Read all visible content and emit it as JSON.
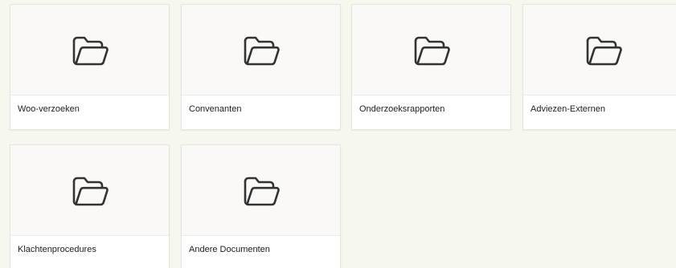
{
  "folders": [
    {
      "label": "Woo-verzoeken",
      "icon": "folder-icon"
    },
    {
      "label": "Convenanten",
      "icon": "folder-icon"
    },
    {
      "label": "Onderzoeksrapporten",
      "icon": "folder-icon"
    },
    {
      "label": "Adviezen-Externen",
      "icon": "folder-icon"
    },
    {
      "label": "Klachtenprocedures",
      "icon": "folder-icon"
    },
    {
      "label": "Andere Documenten",
      "icon": "folder-icon"
    }
  ],
  "colors": {
    "background": "#f6f8ef",
    "card": "#ffffff",
    "thumb": "#faf9f7",
    "icon_stroke": "#333333",
    "text": "#222222"
  }
}
